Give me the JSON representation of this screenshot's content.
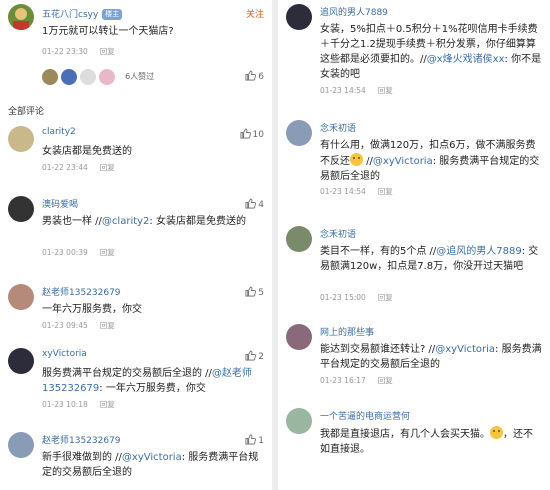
{
  "post": {
    "username": "五花八门csyy",
    "badge": "楼主",
    "follow_label": "关注",
    "text": "1万元就可以转让一个天猫店?",
    "date": "01-22 23:30",
    "reply_label": "回复",
    "likers_count": "6人赞过",
    "like_count": "6"
  },
  "section_title": "全部评论",
  "left_comments": [
    {
      "name": "clarity2",
      "text_parts": [
        {
          "t": "女装店都是免费送的",
          "m": false
        }
      ],
      "date": "01-22 23:44",
      "reply": "回复",
      "likes": "10"
    },
    {
      "name": "澳码爱喝",
      "text_parts": [
        {
          "t": "男装也一样 //",
          "m": false
        },
        {
          "t": "@clarity2",
          "m": true
        },
        {
          "t": ": 女装店都是免费送的",
          "m": false
        }
      ],
      "date": "01-23 00:39",
      "reply": "回复",
      "likes": "4"
    },
    {
      "name": "赵老师135232679",
      "text_parts": [
        {
          "t": "一年六万服务费，你交",
          "m": false
        }
      ],
      "date": "01-23 09:45",
      "reply": "回复",
      "likes": "5"
    },
    {
      "name": "xyVictoria",
      "text_parts": [
        {
          "t": "服务费满平台规定的交易额后全退的 //",
          "m": false
        },
        {
          "t": "@赵老师135232679",
          "m": true
        },
        {
          "t": ": 一年六万服务费，你交",
          "m": false
        }
      ],
      "date": "01-23 10:18",
      "reply": "回复",
      "likes": "2"
    },
    {
      "name": "赵老师135232679",
      "text_parts": [
        {
          "t": "新手很难做到的 //",
          "m": false
        },
        {
          "t": "@xyVictoria",
          "m": true
        },
        {
          "t": ": 服务费满平台规定的交易额后全退的",
          "m": false
        }
      ],
      "date": "",
      "reply": "",
      "likes": "1"
    }
  ],
  "right_comments": [
    {
      "name": "追风的男人7889",
      "text_parts": [
        {
          "t": "女装，5%扣点＋0.5积分＋1%花呗信用卡手续费＋千分之1.2提现手续费＋积分发票，你仔细算算这些都是必须要扣的。//",
          "m": false
        },
        {
          "t": "@x烽火戏诸侯xx",
          "m": true
        },
        {
          "t": ": 你不是女装的吧",
          "m": false
        }
      ],
      "date": "01-23 14:54",
      "reply": "回复",
      "likes": ""
    },
    {
      "name": "念禾初语",
      "text_parts": [
        {
          "t": "有什么用，做满120万，扣点6万，做不满服务费不反还",
          "m": false
        },
        {
          "t": "EMOJI",
          "m": false
        },
        {
          "t": " //",
          "m": false
        },
        {
          "t": "@xyVictoria",
          "m": true
        },
        {
          "t": ": 服务费满平台规定的交易额后全退的",
          "m": false
        }
      ],
      "date": "01-23 14:54",
      "reply": "回复",
      "likes": ""
    },
    {
      "name": "念禾初语",
      "text_parts": [
        {
          "t": "类目不一样，有的5个点 //",
          "m": false
        },
        {
          "t": "@追风的男人7889",
          "m": true
        },
        {
          "t": ": 交易额满120w，扣点是7.8万，你没开过天猫吧",
          "m": false
        }
      ],
      "date": "01-23 15:00",
      "reply": "回复",
      "likes": ""
    },
    {
      "name": "网上的那些事",
      "text_parts": [
        {
          "t": "能达到交易额谁还转让? //",
          "m": false
        },
        {
          "t": "@xyVictoria",
          "m": true
        },
        {
          "t": ": 服务费满平台规定的交易额后全退的",
          "m": false
        }
      ],
      "date": "01-23 16:17",
      "reply": "回复",
      "likes": ""
    },
    {
      "name": "一个苦逼的电商运营何",
      "text_parts": [
        {
          "t": "我都是直接退店，有几个人会买天猫。",
          "m": false
        },
        {
          "t": "EMOJI",
          "m": false
        },
        {
          "t": "，还不如直接退。",
          "m": false
        }
      ],
      "date": "",
      "reply": "",
      "likes": ""
    }
  ]
}
